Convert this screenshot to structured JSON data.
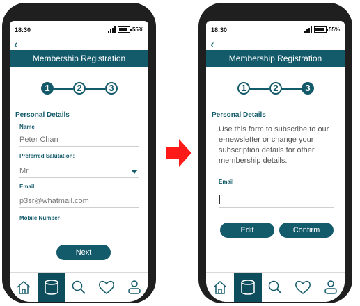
{
  "colors": {
    "accent": "#135a6a",
    "nav_active": "#0d4d5c",
    "arrow": "#ff1a1a"
  },
  "status": {
    "time": "18:30",
    "battery": "55%"
  },
  "icons": {
    "back": "back-arrow-icon",
    "transition": "right-arrow-icon"
  },
  "left": {
    "title": "Membership Registration",
    "steps": [
      "1",
      "2",
      "3"
    ],
    "active_step": 1,
    "section": "Personal Details",
    "name_label": "Name",
    "name_value": "Peter Chan",
    "salutation_label": "Preferred Salutation:",
    "salutation_value": "Mr",
    "email_label": "Email",
    "email_placeholder": "p3sr@whatmail.com",
    "mobile_label": "Mobile Number",
    "next_label": "Next"
  },
  "right": {
    "title": "Membership Registration",
    "steps": [
      "1",
      "2",
      "3"
    ],
    "active_step": 3,
    "section": "Personal Details",
    "info": "Use this form to subscribe to our e-newsletter or change your subscription details for other membership details.",
    "email_label": "Email",
    "edit_label": "Edit",
    "confirm_label": "Confirm"
  },
  "nav": [
    "home-icon",
    "database-icon",
    "search-icon",
    "heart-icon",
    "profile-icon"
  ],
  "nav_active_index": 1
}
